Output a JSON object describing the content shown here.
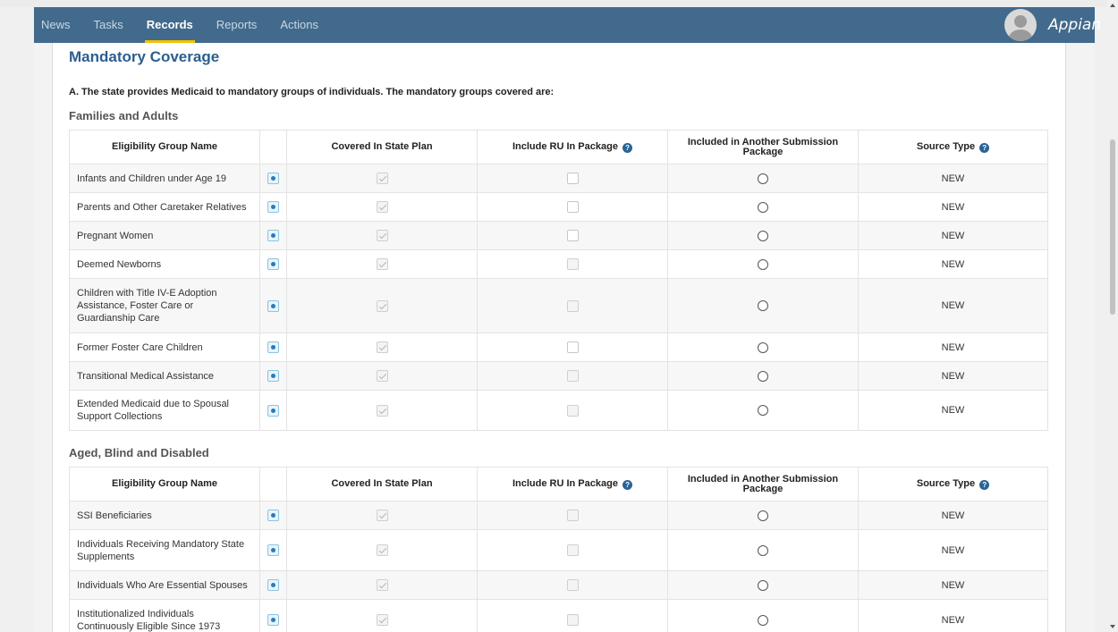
{
  "nav": {
    "items": [
      "News",
      "Tasks",
      "Records",
      "Reports",
      "Actions"
    ],
    "active": "Records",
    "brand": "Appian"
  },
  "page": {
    "title": "Mandatory Coverage",
    "lead": "A. The state provides Medicaid to mandatory groups of individuals. The mandatory groups covered are:"
  },
  "columns": {
    "name": "Eligibility Group Name",
    "covered": "Covered In State Plan",
    "include_ru": "Include RU In Package",
    "included_other": "Included in Another Submission Package",
    "source": "Source Type"
  },
  "sections": [
    {
      "heading": "Families and Adults",
      "rows": [
        {
          "name": "Infants and Children under Age 19",
          "covered": true,
          "ru_enabled": true,
          "source": "NEW"
        },
        {
          "name": "Parents and Other Caretaker Relatives",
          "covered": true,
          "ru_enabled": true,
          "source": "NEW"
        },
        {
          "name": "Pregnant Women",
          "covered": true,
          "ru_enabled": true,
          "source": "NEW"
        },
        {
          "name": "Deemed Newborns",
          "covered": true,
          "ru_enabled": false,
          "source": "NEW"
        },
        {
          "name": "Children with Title IV-E Adoption Assistance, Foster Care or Guardianship Care",
          "covered": true,
          "ru_enabled": false,
          "source": "NEW"
        },
        {
          "name": "Former Foster Care Children",
          "covered": true,
          "ru_enabled": true,
          "source": "NEW"
        },
        {
          "name": "Transitional Medical Assistance",
          "covered": true,
          "ru_enabled": false,
          "source": "NEW"
        },
        {
          "name": "Extended Medicaid due to Spousal Support Collections",
          "covered": true,
          "ru_enabled": false,
          "source": "NEW"
        }
      ]
    },
    {
      "heading": "Aged, Blind and Disabled",
      "rows": [
        {
          "name": "SSI Beneficiaries",
          "covered": true,
          "ru_enabled": false,
          "source": "NEW"
        },
        {
          "name": "Individuals Receiving Mandatory State Supplements",
          "covered": true,
          "ru_enabled": false,
          "source": "NEW"
        },
        {
          "name": "Individuals Who Are Essential Spouses",
          "covered": true,
          "ru_enabled": false,
          "source": "NEW"
        },
        {
          "name": "Institutionalized Individuals Continuously Eligible Since 1973",
          "covered": true,
          "ru_enabled": false,
          "source": "NEW"
        }
      ]
    }
  ]
}
